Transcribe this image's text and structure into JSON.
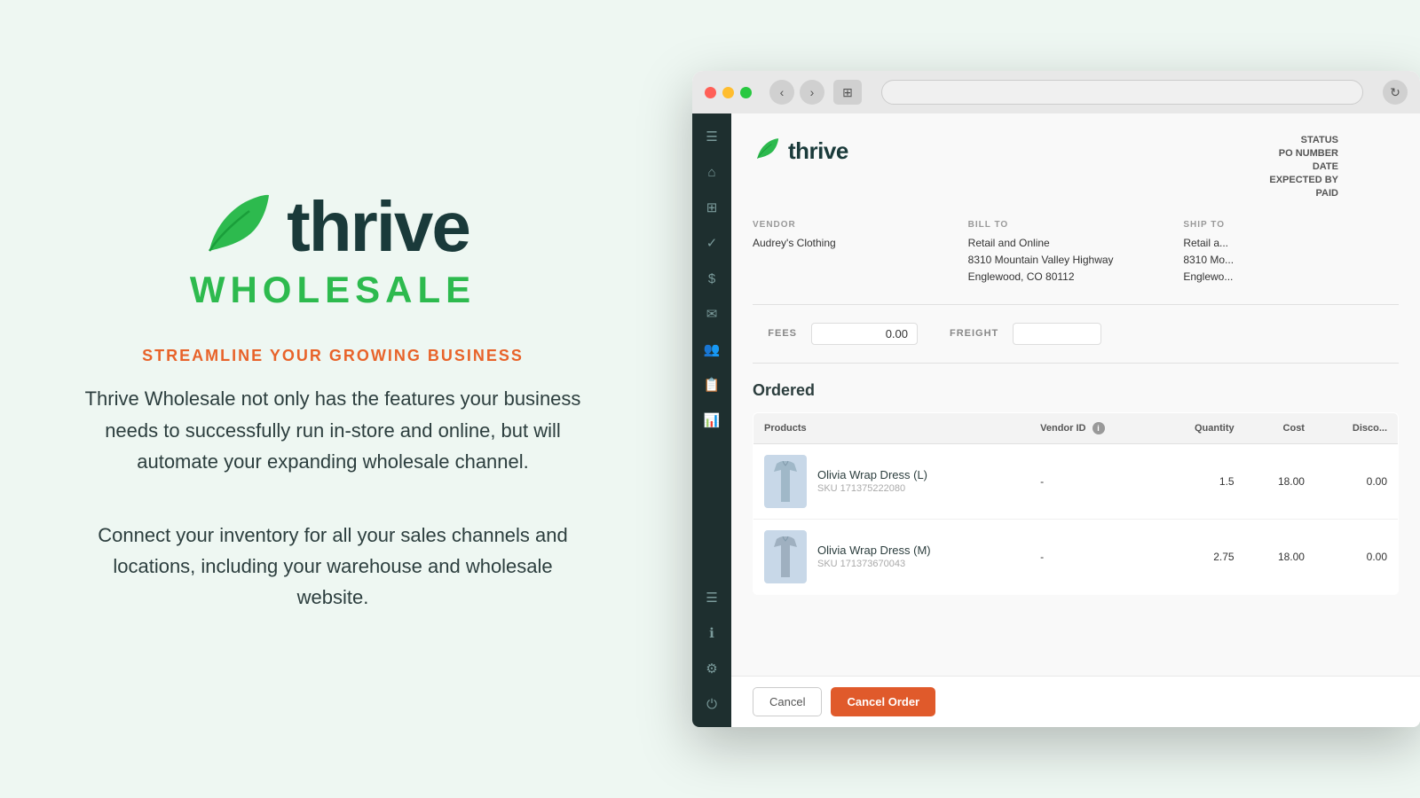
{
  "left": {
    "logo": {
      "thrive": "thrive",
      "wholesale": "WHOLESALE"
    },
    "tagline": "STREAMLINE YOUR GROWING BUSINESS",
    "description1": "Thrive Wholesale not only has the features your business needs to successfully run in-store and online, but will automate your expanding wholesale channel.",
    "description2": "Connect your inventory for all your sales channels and locations, including your warehouse and wholesale website."
  },
  "browser": {
    "url": ""
  },
  "app": {
    "logo": "thrive",
    "order_meta": {
      "status_label": "STATUS",
      "po_number_label": "PO NUMBER",
      "date_label": "DATE",
      "expected_by_label": "EXPECTED BY",
      "paid_label": "PAID"
    },
    "vendor": {
      "label": "VENDOR",
      "name": "Audrey's Clothing"
    },
    "bill_to": {
      "label": "BILL TO",
      "name": "Retail and Online",
      "address1": "8310 Mountain Valley Highway",
      "address2": "Englewood, CO 80112"
    },
    "ship_to": {
      "label": "SHIP TO",
      "name": "Retail a...",
      "address1": "8310 Mo...",
      "address2": "Englewo..."
    },
    "fees": {
      "label": "FEES",
      "value": "0.00"
    },
    "freight": {
      "label": "FREIGHT",
      "value": ""
    },
    "ordered_title": "Ordered",
    "table": {
      "headers": [
        "Products",
        "Vendor ID",
        "Quantity",
        "Cost",
        "Disco..."
      ],
      "rows": [
        {
          "name": "Olivia Wrap Dress (L)",
          "sku": "SKU 171375222080",
          "vendor_id": "-",
          "quantity": "1.5",
          "cost": "18.00",
          "discount": "0.00"
        },
        {
          "name": "Olivia Wrap Dress (M)",
          "sku": "SKU 171373670043",
          "vendor_id": "-",
          "quantity": "2.75",
          "cost": "18.00",
          "discount": "0.00"
        }
      ]
    },
    "buttons": {
      "cancel": "Cancel",
      "cancel_order": "Cancel Order"
    },
    "sidebar_icons": [
      "☰",
      "⌂",
      "⊞",
      "✓",
      "$",
      "✉",
      "👥",
      "📋",
      "📊"
    ],
    "sidebar_bottom_icons": [
      "☰",
      "ℹ",
      "⚙",
      "⏻"
    ]
  }
}
